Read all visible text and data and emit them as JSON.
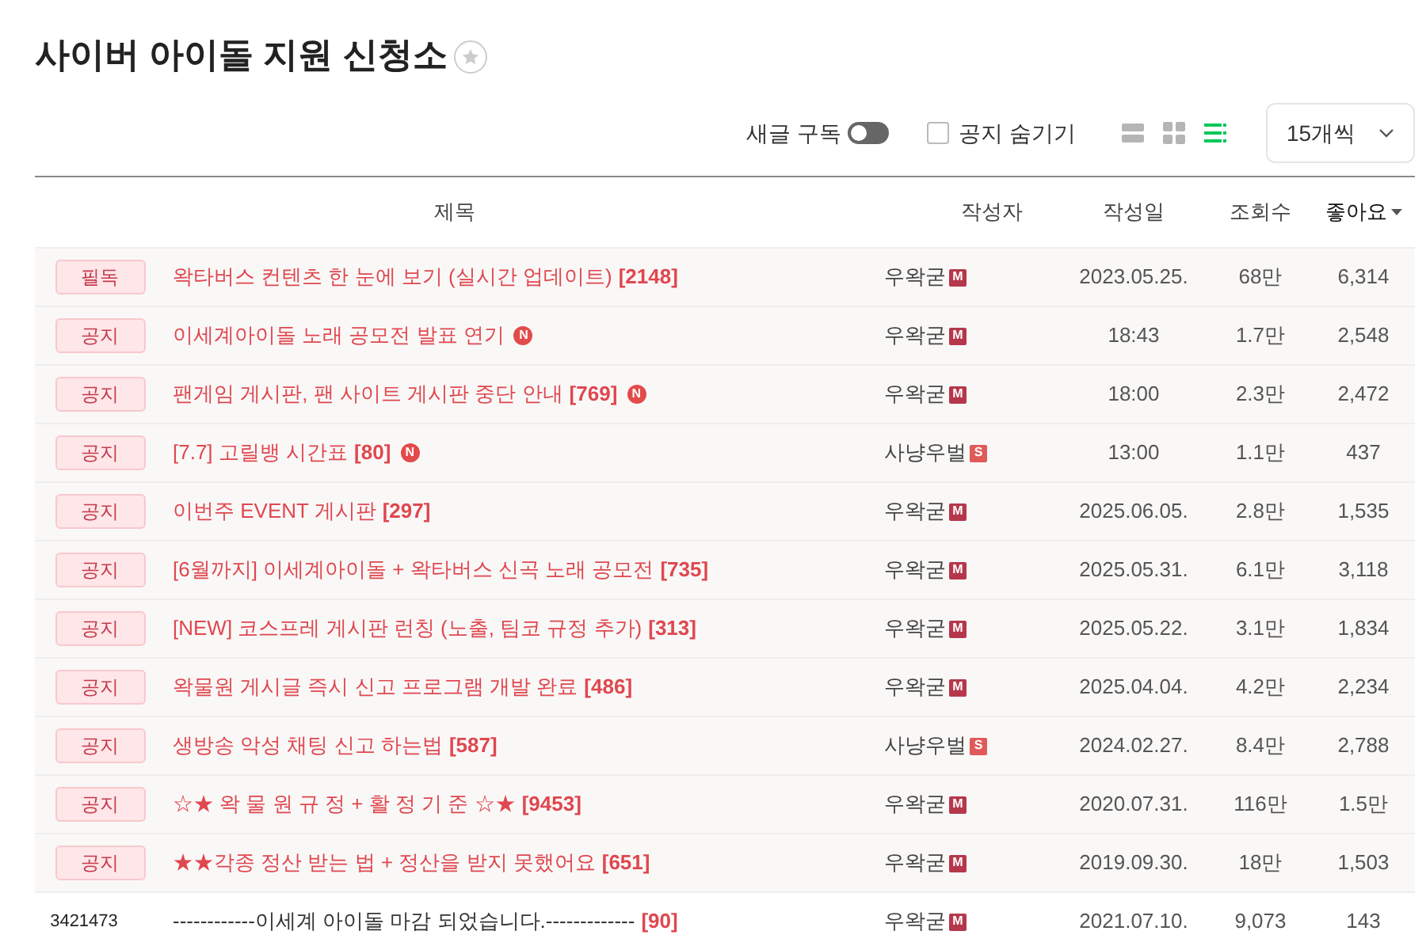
{
  "board": {
    "title": "사이버 아이돌 지원 신청소",
    "favorited": false
  },
  "controls": {
    "subscribe": {
      "label": "새글 구독",
      "on": false
    },
    "hide_notices": {
      "label": "공지 숨기기",
      "checked": false
    },
    "view_modes": [
      {
        "kind": "album",
        "selected": false
      },
      {
        "kind": "card",
        "selected": false
      },
      {
        "kind": "list",
        "selected": true
      }
    ],
    "per_page": "15개씩"
  },
  "table": {
    "columns": [
      {
        "label": "제목",
        "sorted": false
      },
      {
        "label": "작성자",
        "sorted": false
      },
      {
        "label": "작성일",
        "sorted": false
      },
      {
        "label": "조회수",
        "sorted": false
      },
      {
        "label": "좋아요",
        "sorted": true
      }
    ],
    "rows": [
      {
        "kind": "notice",
        "tag": "필독",
        "subject": {
          "title": "왁타버스 컨텐츠 한 눈에 보기 (실시간 업데이트)",
          "comments": "[2148]"
        },
        "author": "우왁굳",
        "role": "M",
        "date": "2023.05.25.",
        "views": "68만",
        "likes": "6,314"
      },
      {
        "kind": "notice",
        "tag": "공지",
        "subject": {
          "title": "이세계아이돌 노래 공모전 발표 연기",
          "new_badge": "N"
        },
        "author": "우왁굳",
        "role": "M",
        "date": "18:43",
        "views": "1.7만",
        "likes": "2,548"
      },
      {
        "kind": "notice",
        "tag": "공지",
        "subject": {
          "title": "팬게임 게시판, 팬 사이트 게시판 중단 안내",
          "comments": "[769]",
          "new_badge": "N"
        },
        "author": "우왁굳",
        "role": "M",
        "date": "18:00",
        "views": "2.3만",
        "likes": "2,472"
      },
      {
        "kind": "notice",
        "tag": "공지",
        "subject": {
          "title": "[7.7] 고릴뱅 시간표",
          "comments": "[80]",
          "new_badge": "N"
        },
        "author": "사냥우벌",
        "role": "S",
        "date": "13:00",
        "views": "1.1만",
        "likes": "437"
      },
      {
        "kind": "notice",
        "tag": "공지",
        "subject": {
          "title": "이번주 EVENT 게시판",
          "comments": "[297]"
        },
        "author": "우왁굳",
        "role": "M",
        "date": "2025.06.05.",
        "views": "2.8만",
        "likes": "1,535"
      },
      {
        "kind": "notice",
        "tag": "공지",
        "subject": {
          "title": "[6월까지] 이세계아이돌 + 왁타버스 신곡 노래 공모전",
          "comments": "[735]"
        },
        "author": "우왁굳",
        "role": "M",
        "date": "2025.05.31.",
        "views": "6.1만",
        "likes": "3,118"
      },
      {
        "kind": "notice",
        "tag": "공지",
        "subject": {
          "title": "[NEW] 코스프레 게시판 런칭 (노출, 팀코 규정 추가)",
          "comments": "[313]"
        },
        "author": "우왁굳",
        "role": "M",
        "date": "2025.05.22.",
        "views": "3.1만",
        "likes": "1,834"
      },
      {
        "kind": "notice",
        "tag": "공지",
        "subject": {
          "title": "왁물원 게시글 즉시 신고 프로그램 개발 완료",
          "comments": "[486]"
        },
        "author": "우왁굳",
        "role": "M",
        "date": "2025.04.04.",
        "views": "4.2만",
        "likes": "2,234"
      },
      {
        "kind": "notice",
        "tag": "공지",
        "subject": {
          "title": "생방송 악성 채팅 신고 하는법",
          "comments": "[587]"
        },
        "author": "사냥우벌",
        "role": "S",
        "date": "2024.02.27.",
        "views": "8.4만",
        "likes": "2,788"
      },
      {
        "kind": "notice",
        "tag": "공지",
        "subject": {
          "title": "☆★ 왁 물 원 규 정 + 활 정 기 준 ☆★",
          "comments": "[9453]"
        },
        "author": "우왁굳",
        "role": "M",
        "date": "2020.07.31.",
        "views": "116만",
        "likes": "1.5만"
      },
      {
        "kind": "notice",
        "tag": "공지",
        "subject": {
          "title": "★★각종 정산 받는 법 + 정산을 받지 못했어요",
          "comments": "[651]"
        },
        "author": "우왁굳",
        "role": "M",
        "date": "2019.09.30.",
        "views": "18만",
        "likes": "1,503"
      },
      {
        "kind": "post",
        "number": "3421473",
        "subject": {
          "title": "------------이세계 아이돌 마감 되었습니다.-------------",
          "comments": "[90]"
        },
        "author": "우왁굳",
        "role": "M",
        "date": "2021.07.10.",
        "views": "9,073",
        "likes": "143"
      }
    ]
  }
}
